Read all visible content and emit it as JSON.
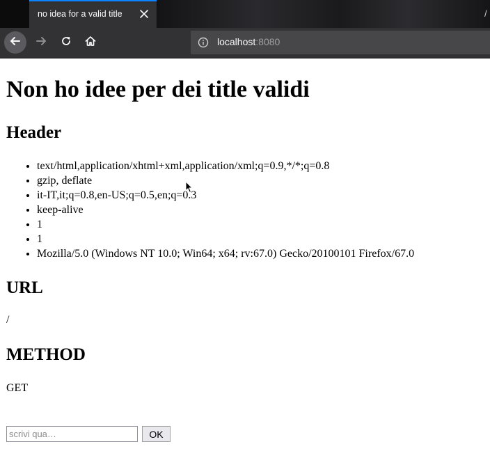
{
  "browser": {
    "tab_title": "no idea for a valid title",
    "address_host": "localhost",
    "address_port": ":8080",
    "tab_edge_glyph": "/"
  },
  "icons": {
    "back": "back-arrow-icon",
    "forward": "forward-arrow-icon",
    "reload": "reload-icon",
    "home": "home-icon",
    "info": "info-icon",
    "close": "close-icon"
  },
  "page": {
    "title": "Non ho idee per dei title validi",
    "header_heading": "Header",
    "headers": [
      "text/html,application/xhtml+xml,application/xml;q=0.9,*/*;q=0.8",
      "gzip, deflate",
      "it-IT,it;q=0.8,en-US;q=0.5,en;q=0.3",
      "keep-alive",
      "1",
      "1",
      "Mozilla/5.0 (Windows NT 10.0; Win64; x64; rv:67.0) Gecko/20100101 Firefox/67.0"
    ],
    "url_heading": "URL",
    "url_value": "/",
    "method_heading": "METHOD",
    "method_value": "GET",
    "input_value": "",
    "input_placeholder": "scrivi qua…",
    "ok_label": "OK"
  },
  "colors": {
    "tab_accent": "#0a84ff",
    "chrome_dark": "#0c0c0d",
    "toolbar": "#323234",
    "urlbar": "#474749"
  }
}
